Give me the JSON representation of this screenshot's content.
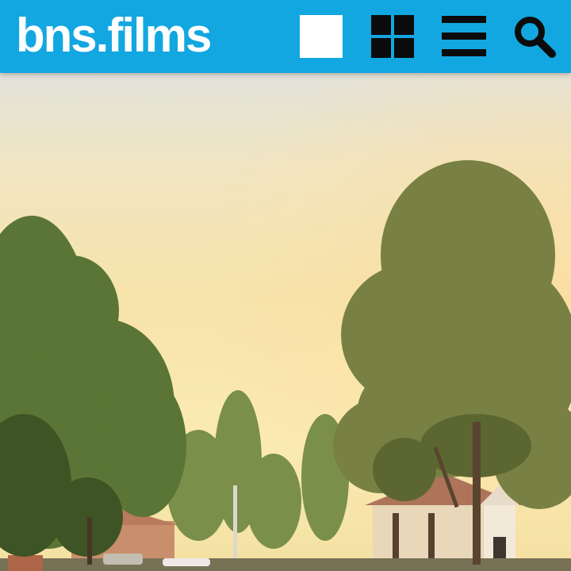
{
  "header": {
    "logo_text": "bns.films",
    "background_color": "#12a7e0",
    "buttons": [
      {
        "name": "single-view-button",
        "icon": "square-icon"
      },
      {
        "name": "grid-view-button",
        "icon": "grid-icon"
      },
      {
        "name": "menu-button",
        "icon": "hamburger-menu-icon"
      },
      {
        "name": "search-button",
        "icon": "search-icon"
      }
    ]
  },
  "hero": {
    "image": "suburban-street-trees-sky-photo"
  }
}
